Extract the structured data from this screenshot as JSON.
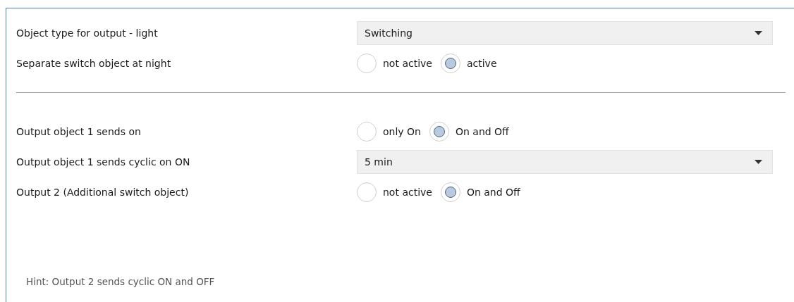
{
  "rows": [
    {
      "kind": "dropdown",
      "label": "Object type for output - light",
      "value": "Switching"
    },
    {
      "kind": "radio",
      "label": "Separate switch object at night",
      "options": [
        {
          "label": "not active",
          "selected": false
        },
        {
          "label": "active",
          "selected": true
        }
      ]
    },
    {
      "kind": "divider"
    },
    {
      "kind": "radio",
      "label": "Output object 1 sends on",
      "options": [
        {
          "label": "only On",
          "selected": false
        },
        {
          "label": "On and Off",
          "selected": true
        }
      ]
    },
    {
      "kind": "dropdown",
      "label": "Output object 1 sends cyclic on ON",
      "value": "5 min"
    },
    {
      "kind": "radio",
      "label": "Output 2 (Additional switch object)",
      "options": [
        {
          "label": "not active",
          "selected": false
        },
        {
          "label": "On and Off",
          "selected": true
        }
      ]
    },
    {
      "kind": "hint",
      "text": "Hint: Output 2 sends cyclic ON and OFF"
    }
  ]
}
